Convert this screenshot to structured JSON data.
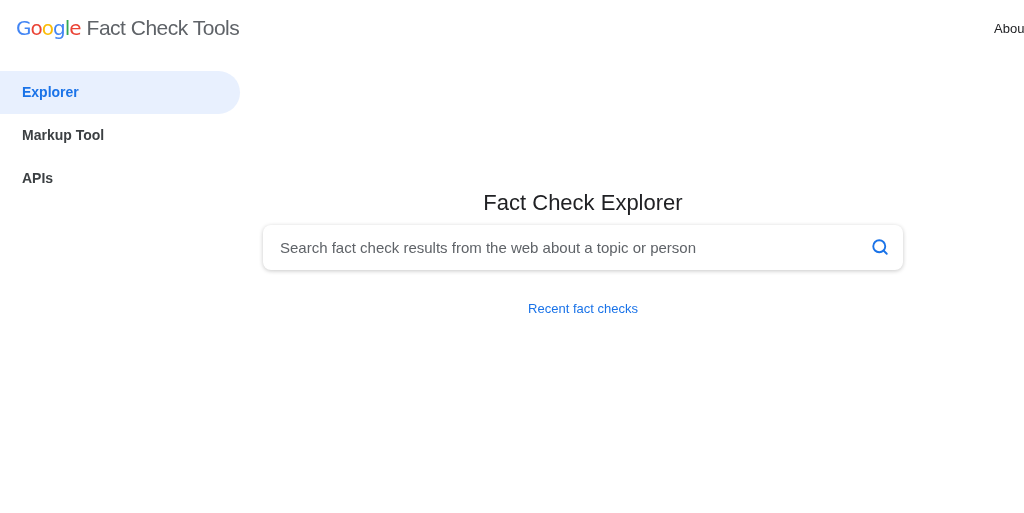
{
  "header": {
    "logo": "Google",
    "product": "Fact Check Tools",
    "nav_link": "Abou"
  },
  "sidebar": {
    "items": [
      {
        "label": "Explorer",
        "selected": true
      },
      {
        "label": "Markup Tool",
        "selected": false
      },
      {
        "label": "APIs",
        "selected": false
      }
    ]
  },
  "main": {
    "title": "Fact Check Explorer",
    "search": {
      "placeholder": "Search fact check results from the web about a topic or person"
    },
    "link": "Recent fact checks"
  }
}
